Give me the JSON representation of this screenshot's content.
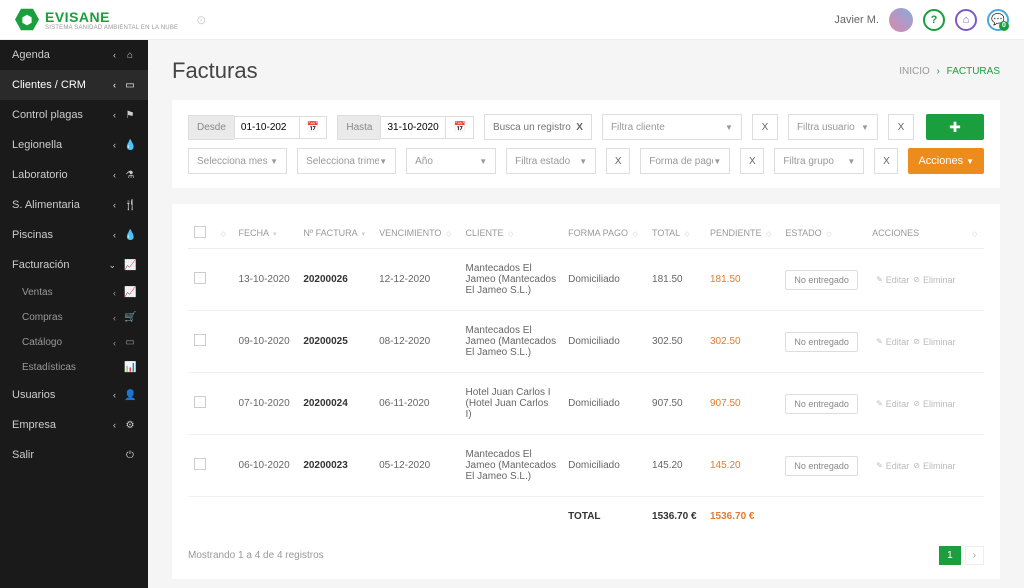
{
  "brand": {
    "name": "EVISANE",
    "sub": "SISTEMA SANIDAD AMBIENTAL EN LA NUBE"
  },
  "user": {
    "name": "Javier M."
  },
  "sidebar": {
    "items": [
      {
        "label": "Agenda",
        "icon": "⌂"
      },
      {
        "label": "Clientes / CRM",
        "icon": "▭",
        "active": true
      },
      {
        "label": "Control plagas",
        "icon": "⚑"
      },
      {
        "label": "Legionella",
        "icon": "💧"
      },
      {
        "label": "Laboratorio",
        "icon": "⚗"
      },
      {
        "label": "S. Alimentaria",
        "icon": "🍴"
      },
      {
        "label": "Piscinas",
        "icon": "💧"
      },
      {
        "label": "Facturación",
        "icon": "📈",
        "expanded": true
      },
      {
        "label": "Usuarios",
        "icon": "👤"
      },
      {
        "label": "Empresa",
        "icon": "⚙"
      },
      {
        "label": "Salir",
        "icon": "⏻"
      }
    ],
    "sub": [
      {
        "label": "Ventas",
        "icon": "📈"
      },
      {
        "label": "Compras",
        "icon": "🛒"
      },
      {
        "label": "Catálogo",
        "icon": "▭"
      },
      {
        "label": "Estadísticas",
        "icon": "📊"
      }
    ]
  },
  "page": {
    "title": "Facturas"
  },
  "breadcrumb": {
    "home": "INICIO",
    "current": "FACTURAS"
  },
  "filters": {
    "desde_label": "Desde",
    "desde_value": "01-10-202",
    "hasta_label": "Hasta",
    "hasta_value": "31-10-2020",
    "search_placeholder": "Busca un registro",
    "filtra_cliente": "Filtra cliente",
    "filtra_usuario": "Filtra usuario",
    "sel_mes": "Selecciona mes",
    "sel_trimestre": "Selecciona trimestre",
    "sel_anio": "Año",
    "filtra_estado": "Filtra estado",
    "forma_pago": "Forma de pago",
    "filtra_grupo": "Filtra grupo",
    "acciones_btn": "Acciones"
  },
  "table": {
    "headers": {
      "fecha": "FECHA",
      "nfactura": "Nº FACTURA",
      "venc": "VENCIMIENTO",
      "cliente": "CLIENTE",
      "forma": "FORMA PAGO",
      "total": "TOTAL",
      "pendiente": "PENDIENTE",
      "estado": "ESTADO",
      "acciones": "ACCIONES"
    },
    "rows": [
      {
        "fecha": "13-10-2020",
        "num": "20200026",
        "venc": "12-12-2020",
        "cliente": "Mantecados El Jameo (Mantecados El Jameo S.L.)",
        "forma": "Domiciliado",
        "total": "181.50",
        "pend": "181.50",
        "estado": "No entregado"
      },
      {
        "fecha": "09-10-2020",
        "num": "20200025",
        "venc": "08-12-2020",
        "cliente": "Mantecados El Jameo (Mantecados El Jameo S.L.)",
        "forma": "Domiciliado",
        "total": "302.50",
        "pend": "302.50",
        "estado": "No entregado"
      },
      {
        "fecha": "07-10-2020",
        "num": "20200024",
        "venc": "06-11-2020",
        "cliente": "Hotel Juan Carlos I (Hotel Juan Carlos I)",
        "forma": "Domiciliado",
        "total": "907.50",
        "pend": "907.50",
        "estado": "No entregado"
      },
      {
        "fecha": "06-10-2020",
        "num": "20200023",
        "venc": "05-12-2020",
        "cliente": "Mantecados El Jameo (Mantecados El Jameo S.L.)",
        "forma": "Domiciliado",
        "total": "145.20",
        "pend": "145.20",
        "estado": "No entregado"
      }
    ],
    "totals": {
      "label": "TOTAL",
      "total": "1536.70 €",
      "pend": "1536.70 €"
    },
    "actions": {
      "editar": "Editar",
      "eliminar": "Eliminar"
    },
    "footer": "Mostrando 1 a 4 de 4 registros",
    "page1": "1"
  }
}
